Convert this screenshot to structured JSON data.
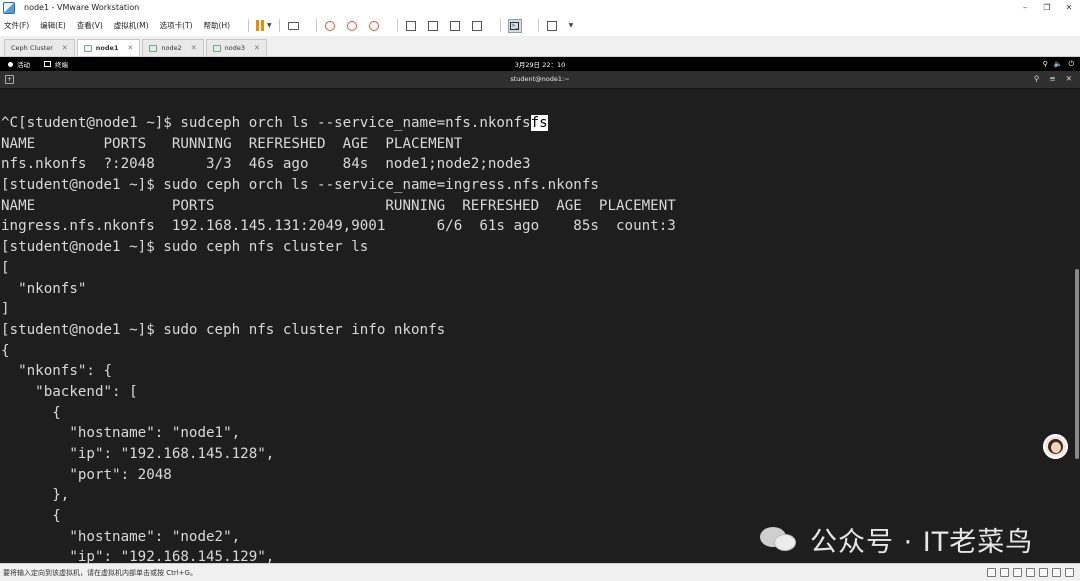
{
  "window": {
    "title": "node1 - VMware Workstation",
    "controls": [
      "–",
      "❐",
      "✕"
    ]
  },
  "menu": [
    "文件(F)",
    "编辑(E)",
    "查看(V)",
    "虚拟机(M)",
    "选项卡(T)",
    "帮助(H)"
  ],
  "tabs": [
    {
      "label": "Ceph Cluster",
      "active": false
    },
    {
      "label": "node1",
      "active": true
    },
    {
      "label": "node2",
      "active": false
    },
    {
      "label": "node3",
      "active": false
    }
  ],
  "gnome": {
    "activities": "活动",
    "app": "终端",
    "clock": "3月29日 22：10",
    "sys_icons": [
      "⚲",
      "🔈",
      "⏻"
    ]
  },
  "terminal": {
    "title": "student@node1:~",
    "header_icons": [
      "⚲",
      "≡",
      "✕"
    ],
    "lines": [
      "^C[student@node1 ~]$ sudceph orch ls --service_name=nfs.nkonfs",
      "NAME        PORTS   RUNNING  REFRESHED  AGE  PLACEMENT",
      "nfs.nkonfs  ?:2048      3/3  46s ago    84s  node1;node2;node3",
      "[student@node1 ~]$ sudo ceph orch ls --service_name=ingress.nfs.nkonfs",
      "NAME                PORTS                    RUNNING  REFRESHED  AGE  PLACEMENT",
      "ingress.nfs.nkonfs  192.168.145.131:2049,9001      6/6  61s ago    85s  count:3",
      "[student@node1 ~]$ sudo ceph nfs cluster ls",
      "[",
      "  \"nkonfs\"",
      "]",
      "[student@node1 ~]$ sudo ceph nfs cluster info nkonfs",
      "{",
      "  \"nkonfs\": {",
      "    \"backend\": [",
      "      {",
      "        \"hostname\": \"node1\",",
      "        \"ip\": \"192.168.145.128\",",
      "        \"port\": 2048",
      "      },",
      "      {",
      "        \"hostname\": \"node2\",",
      "        \"ip\": \"192.168.145.129\","
    ],
    "cursor_text": "fs"
  },
  "watermark": "公众号 · IT老菜鸟",
  "status": "要将输入定向到该虚拟机，请在虚拟机内部单击或按 Ctrl+G。"
}
